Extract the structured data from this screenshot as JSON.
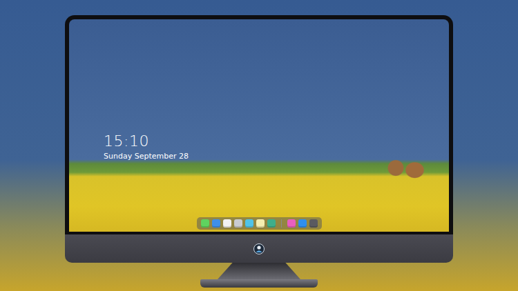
{
  "clock": {
    "time": "15:10",
    "date": "Sunday September 28"
  },
  "dock": {
    "items": [
      {
        "kind": "app",
        "color": "#5fd35f"
      },
      {
        "kind": "app",
        "color": "#3f8fe8"
      },
      {
        "kind": "app",
        "color": "#f2f2f2"
      },
      {
        "kind": "app",
        "color": "#c9ccd1"
      },
      {
        "kind": "app",
        "color": "#4fc3e8"
      },
      {
        "kind": "app",
        "color": "#f4eeb0"
      },
      {
        "kind": "app",
        "color": "#3fae8a"
      },
      {
        "kind": "separator",
        "color": "#8a8a8a"
      },
      {
        "kind": "app",
        "color": "#e95fbf"
      },
      {
        "kind": "app",
        "color": "#2f8fef"
      },
      {
        "kind": "app",
        "color": "#5a5a60"
      }
    ]
  }
}
